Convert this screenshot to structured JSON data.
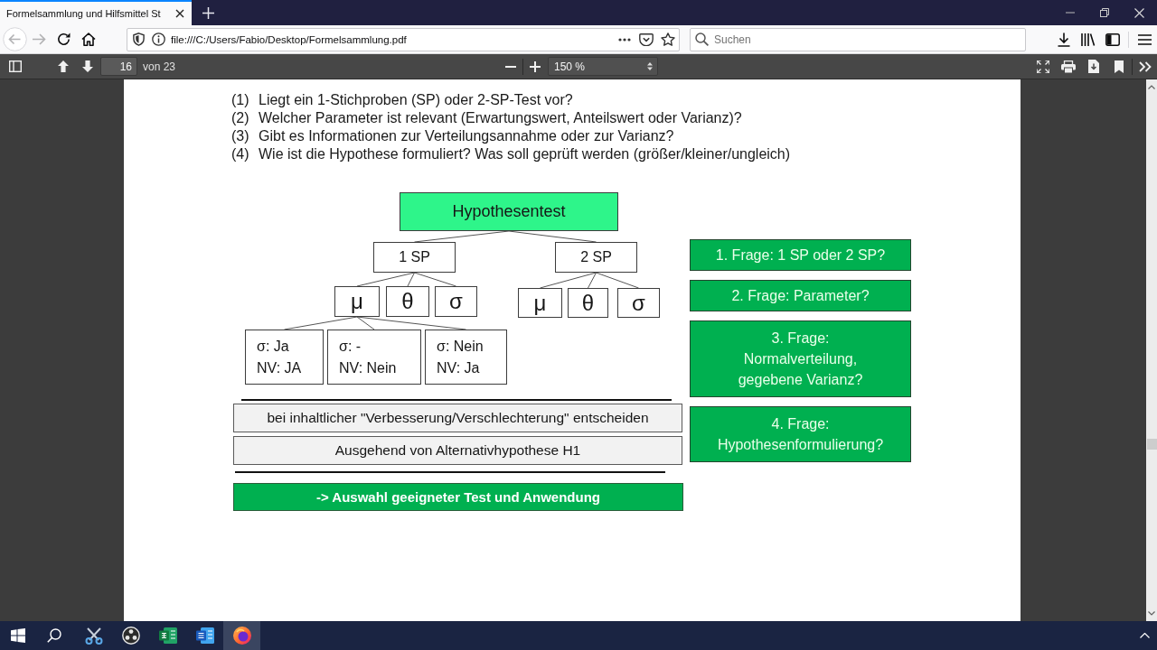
{
  "browser": {
    "tabs": [
      {
        "title": "Formelsammlung und Hilfsmittel St",
        "selected": true
      }
    ],
    "navigation": {
      "back": {
        "disabled": true
      },
      "forward": {
        "disabled": true
      }
    },
    "address": {
      "value": "file:///C:/Users/Fabio/Desktop/Formelsammlung.pdf"
    },
    "search": {
      "placeholder": "Suchen"
    }
  },
  "pdf_toolbar": {
    "page": {
      "value": "16"
    },
    "page_count": "von 23",
    "zoom": "150 %"
  },
  "document": {
    "questions": [
      {
        "number": "(1)",
        "text": "Liegt ein 1-Stichproben (SP) oder 2-SP-Test vor?"
      },
      {
        "number": "(2)",
        "text": "Welcher Parameter ist relevant (Erwartungswert, Anteilswert oder Varianz)?"
      },
      {
        "number": "(3)",
        "text": "Gibt es Informationen zur Verteilungsannahme oder zur Varianz?"
      },
      {
        "number": "(4)",
        "text": "Wie ist die Hypothese formuliert? Was soll geprüft werden (größer/kleiner/ungleich)"
      }
    ],
    "diagram": {
      "root": {
        "label": "Hypothesentest",
        "kind": "title",
        "children": [
          {
            "label": "1 SP",
            "kind": "group",
            "children": [
              {
                "label": "μ",
                "kind": "parameter",
                "children": [
                  {
                    "lines": [
                      "σ: Ja",
                      "NV: JA"
                    ],
                    "kind": "case"
                  },
                  {
                    "lines": [
                      "σ: -",
                      "NV: Nein"
                    ],
                    "kind": "case"
                  },
                  {
                    "lines": [
                      "σ: Nein",
                      "NV: Ja"
                    ],
                    "kind": "case"
                  }
                ]
              },
              {
                "label": "θ",
                "kind": "parameter"
              },
              {
                "label": "σ",
                "kind": "parameter"
              }
            ]
          },
          {
            "label": "2 SP",
            "kind": "group",
            "children": [
              {
                "label": "μ",
                "kind": "parameter"
              },
              {
                "label": "θ",
                "kind": "parameter"
              },
              {
                "label": "σ",
                "kind": "parameter"
              }
            ]
          }
        ]
      }
    },
    "notes": [
      "bei inhaltlicher \"Verbesserung/Verschlechterung\" entscheiden",
      "Ausgehend von Alternativhypothese H1"
    ],
    "conclusion": "-> Auswahl geeigneter Test und Anwendung",
    "steps": [
      {
        "lines": [
          "1. Frage: 1 SP oder 2 SP?"
        ]
      },
      {
        "lines": [
          "2. Frage: Parameter?"
        ]
      },
      {
        "lines": [
          "3. Frage:",
          "Normalverteilung,",
          "gegebene Varianz?"
        ]
      },
      {
        "lines": [
          "4. Frage:",
          "Hypothesenformulierung?"
        ]
      }
    ]
  },
  "taskbar": {
    "apps": [
      {
        "selected": false
      },
      {
        "selected": false
      },
      {
        "selected": false
      },
      {
        "selected": false
      },
      {
        "selected": true
      }
    ]
  }
}
